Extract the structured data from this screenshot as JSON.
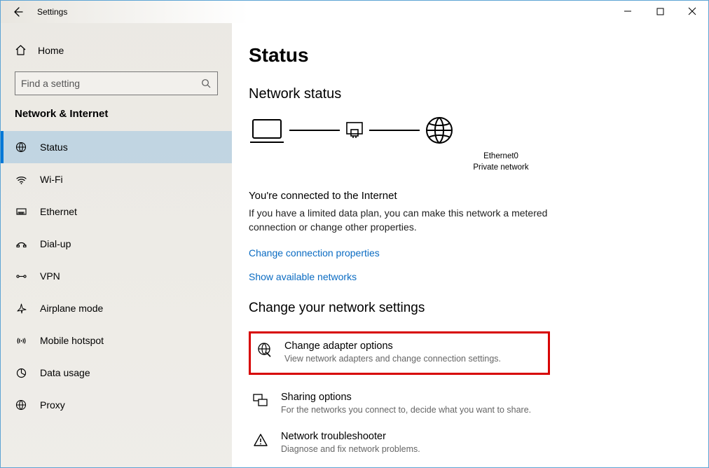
{
  "window": {
    "title": "Settings"
  },
  "sidebar": {
    "home": "Home",
    "searchPlaceholder": "Find a setting",
    "section": "Network & Internet",
    "items": [
      {
        "label": "Status"
      },
      {
        "label": "Wi-Fi"
      },
      {
        "label": "Ethernet"
      },
      {
        "label": "Dial-up"
      },
      {
        "label": "VPN"
      },
      {
        "label": "Airplane mode"
      },
      {
        "label": "Mobile hotspot"
      },
      {
        "label": "Data usage"
      },
      {
        "label": "Proxy"
      }
    ]
  },
  "main": {
    "h1": "Status",
    "h2": "Network status",
    "diagram": {
      "adapter": "Ethernet0",
      "network": "Private network"
    },
    "connected": "You're connected to the Internet",
    "connectedDesc": "If you have a limited data plan, you can make this network a metered connection or change other properties.",
    "link1": "Change connection properties",
    "link2": "Show available networks",
    "h3": "Change your network settings",
    "opts": [
      {
        "title": "Change adapter options",
        "desc": "View network adapters and change connection settings."
      },
      {
        "title": "Sharing options",
        "desc": "For the networks you connect to, decide what you want to share."
      },
      {
        "title": "Network troubleshooter",
        "desc": "Diagnose and fix network problems."
      }
    ]
  }
}
